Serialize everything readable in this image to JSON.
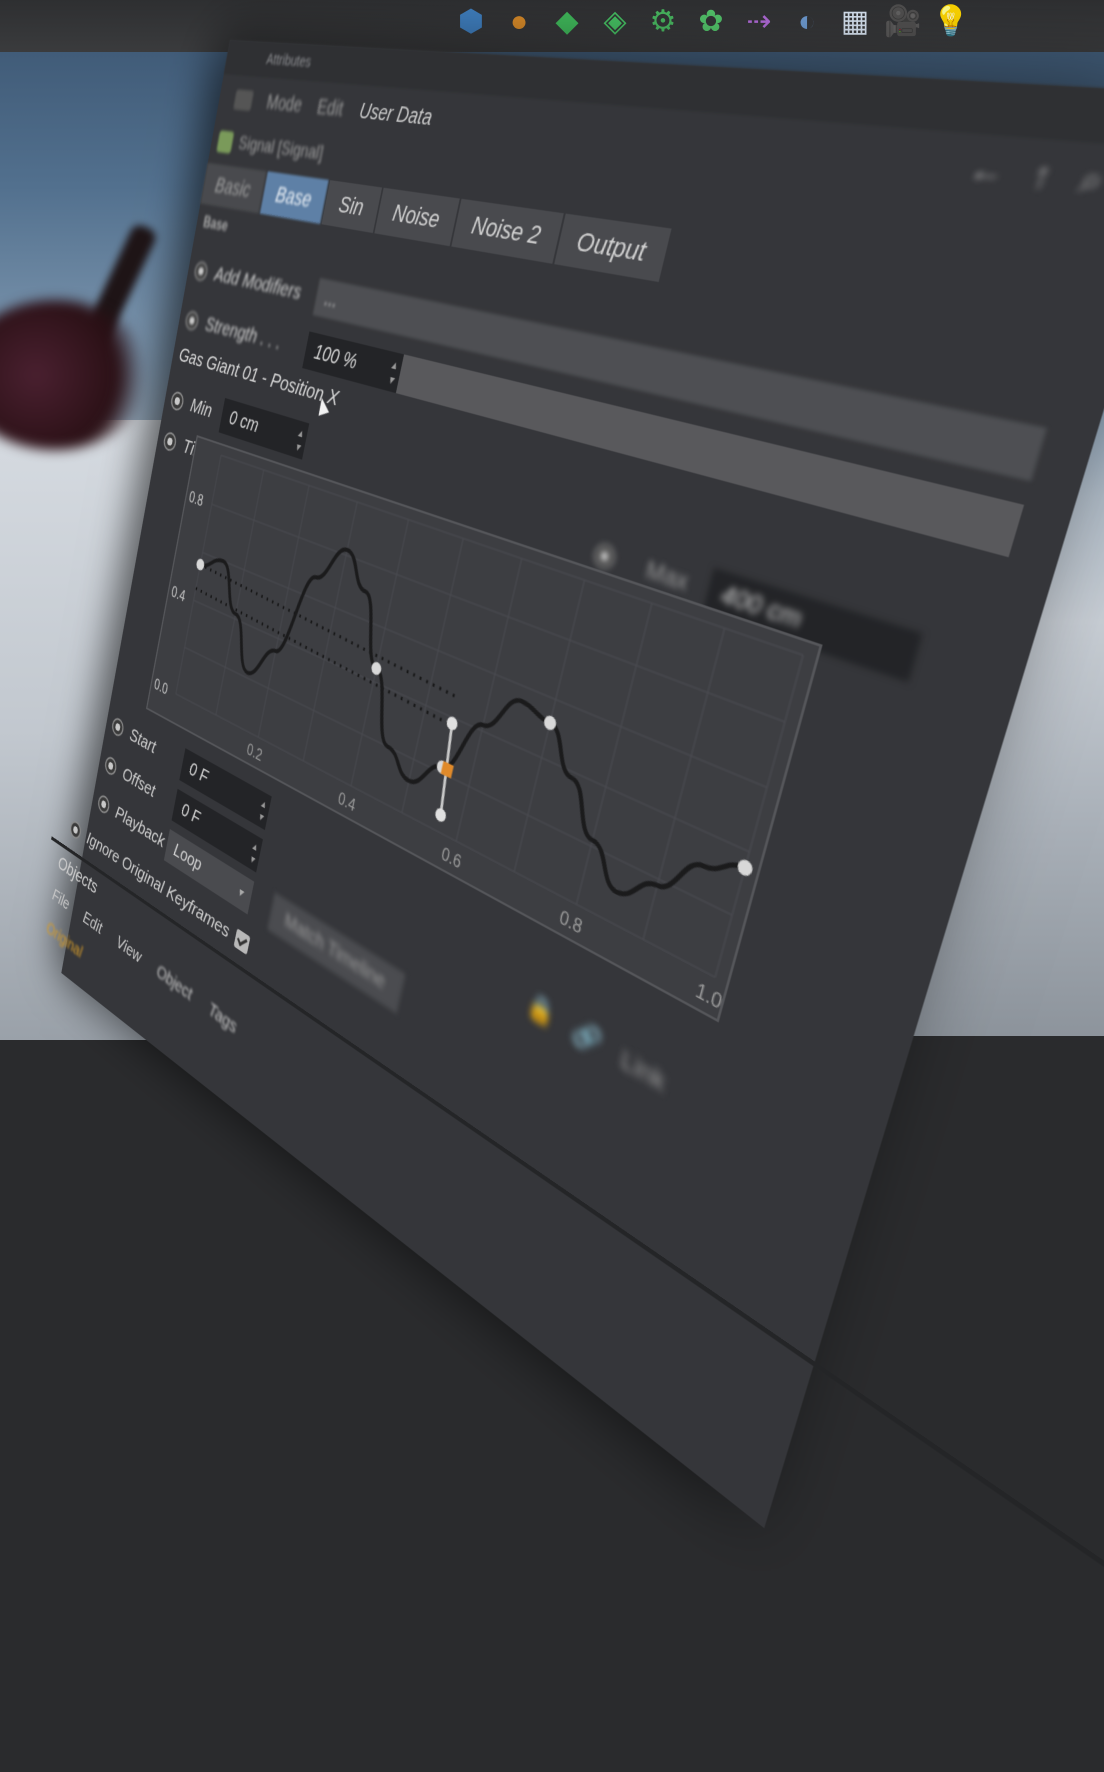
{
  "toolbar": {
    "icons": [
      {
        "name": "cube-icon",
        "glyph": "⬢",
        "color": "#3f7fc0"
      },
      {
        "name": "orange-object-icon",
        "glyph": "●",
        "color": "#d88a28"
      },
      {
        "name": "green-generator-icon",
        "glyph": "◆",
        "color": "#3fb85a"
      },
      {
        "name": "green-array-icon",
        "glyph": "◈",
        "color": "#45c062"
      },
      {
        "name": "gear-icon",
        "glyph": "⚙",
        "color": "#48b860"
      },
      {
        "name": "cloner-icon",
        "glyph": "✿",
        "color": "#52c46a"
      },
      {
        "name": "deformer-icon",
        "glyph": "⇢",
        "color": "#b06ad8"
      },
      {
        "name": "sphere-cut-icon",
        "glyph": "◐",
        "color": "#6d9ad0"
      },
      {
        "name": "floor-grid-icon",
        "glyph": "▦",
        "color": "#d8e4f2"
      },
      {
        "name": "camera-icon",
        "glyph": "🎥",
        "color": "#f0f0f0"
      },
      {
        "name": "light-bulb-icon",
        "glyph": "💡",
        "color": "#e6e6e6"
      }
    ]
  },
  "panel": {
    "title": "Attributes",
    "menu": {
      "mode": "Mode",
      "edit": "Edit",
      "user_data": "User Data"
    },
    "nav": {
      "back": "←",
      "up": "↑",
      "more": "⌕"
    },
    "object_name": "Signal [Signal]",
    "tabs": [
      {
        "label": "Basic",
        "state": "blurred"
      },
      {
        "label": "Base",
        "state": "active"
      },
      {
        "label": "Sin",
        "state": "normal"
      },
      {
        "label": "Noise",
        "state": "normal"
      },
      {
        "label": "Noise 2",
        "state": "normal"
      },
      {
        "label": "Output",
        "state": "normal"
      }
    ],
    "section_heading": "Base",
    "add_modifiers": {
      "label": "Add Modifiers",
      "value": "..."
    },
    "strength": {
      "label": "Strength . . .",
      "value": "100 %"
    },
    "graph_title": "Gas Giant 01 - Position X",
    "min": {
      "label": "Min",
      "value": "0 cm"
    },
    "time": {
      "label": "Time >"
    },
    "max": {
      "label": "Max",
      "value": "400 cm"
    },
    "graph": {
      "y_ticks": [
        "0.8",
        "0.4",
        "0.0"
      ],
      "x_ticks": [
        "0.2",
        "0.4",
        "0.6",
        "0.8",
        "1.0"
      ]
    },
    "start": {
      "label": "Start",
      "value": "0 F"
    },
    "offset": {
      "label": "Offset",
      "value": "0 F"
    },
    "playback": {
      "label": "Playback",
      "value": "Loop",
      "arrow": "▾"
    },
    "ignore": {
      "label": "Ignore Original Keyframes"
    },
    "match_button": "Match Timeline",
    "bottom_right": {
      "lock": "🔒",
      "link": "🔗",
      "label": "Link"
    },
    "objects_tab": "Objects",
    "objects_menu": {
      "file": "File",
      "edit": "Edit",
      "view": "View",
      "object": "Object",
      "tags": "Tags"
    },
    "orange_label": "Original"
  },
  "chart_data": {
    "type": "line",
    "title": "",
    "xlabel": "Time",
    "ylabel": "",
    "xlim": [
      0,
      1
    ],
    "ylim": [
      0,
      1
    ],
    "x_ticks": [
      0.2,
      0.4,
      0.6,
      0.8,
      1.0
    ],
    "y_ticks": [
      0.0,
      0.4,
      0.8
    ],
    "series": [
      {
        "x": [
          0.0,
          0.05,
          0.1,
          0.15,
          0.2,
          0.25,
          0.3,
          0.35,
          0.4,
          0.45,
          0.5,
          0.55,
          0.6,
          0.65,
          0.7,
          0.75,
          0.8,
          0.85,
          0.9,
          0.95,
          1.0
        ],
        "y": [
          0.55,
          0.6,
          0.42,
          0.22,
          0.35,
          0.68,
          0.82,
          0.7,
          0.45,
          0.2,
          0.12,
          0.22,
          0.42,
          0.55,
          0.52,
          0.38,
          0.22,
          0.1,
          0.18,
          0.3,
          0.35
        ]
      }
    ],
    "dotted_guides": [
      0.55,
      0.45
    ]
  }
}
